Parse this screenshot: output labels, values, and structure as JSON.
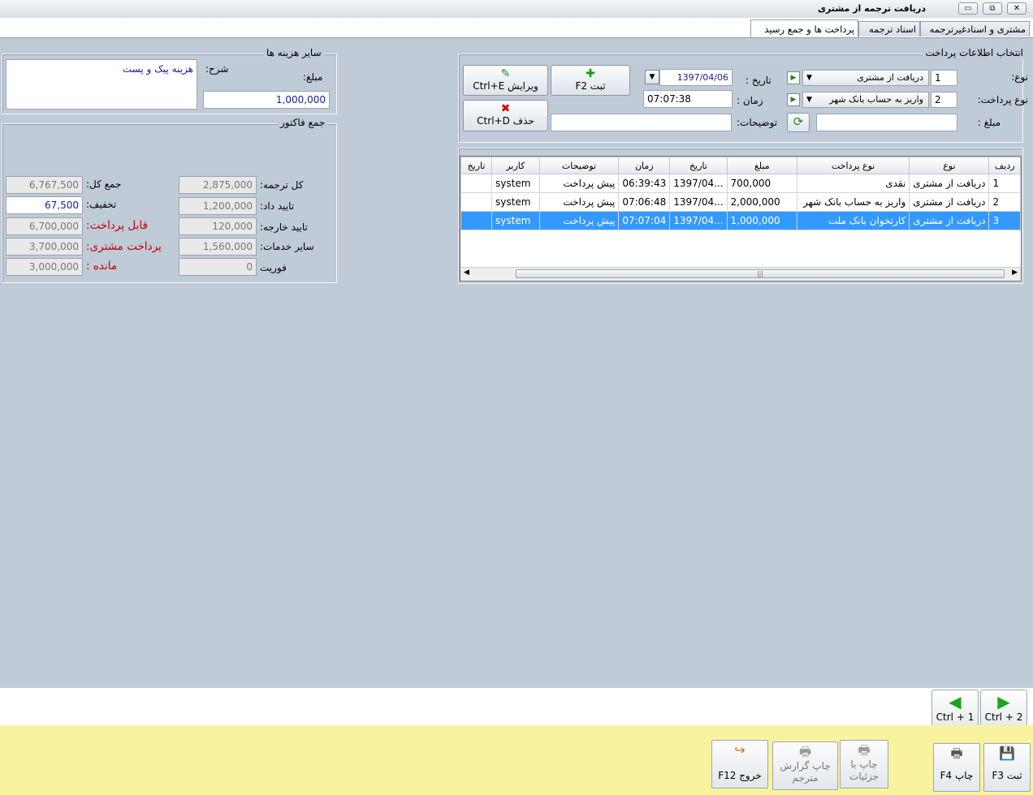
{
  "window": {
    "title": "دریافت ترجمه از مشتری"
  },
  "tabs": [
    {
      "label": "مشتری و اسنادغیرترجمه"
    },
    {
      "label": "اسناد ترجمه"
    },
    {
      "label": "پرداخت ها و جمع رسید"
    }
  ],
  "payment": {
    "title": "انتخاب اطلاعات پرداخت",
    "type_label": "نوع:",
    "type_code": "1",
    "type_value": "دریافت از مشتری",
    "paytype_label": "نوع پرداخت:",
    "paytype_code": "2",
    "paytype_value": "واریز به حساب بانک شهر",
    "amount_label": "مبلغ :",
    "amount_value": "",
    "date_label": "تاریخ :",
    "date_value": "1397/04/06",
    "time_label": "زمان :",
    "time_value": "07:07:38",
    "desc_label": "توضیحات:",
    "desc_value": "",
    "save_btn": "ثبت  F2",
    "edit_btn": "ویرایش  Ctrl+E",
    "delete_btn": "حذف    Ctrl+D"
  },
  "grid": {
    "columns": [
      "ردیف",
      "نوع",
      "نوع پرداخت",
      "مبلغ",
      "تاریخ",
      "زمان",
      "توضیحات",
      "کاربر",
      "تاریخ"
    ],
    "rows": [
      {
        "idx": "1",
        "type": "دریافت از مشتری",
        "paytype": "نقدی",
        "amount": "700,000",
        "date": "1397/04...",
        "time": "06:39:43",
        "desc": "پیش پرداخت",
        "user": "system",
        "date2": ""
      },
      {
        "idx": "2",
        "type": "دریافت از مشتری",
        "paytype": "واریز به حساب بانک شهر",
        "amount": "2,000,000",
        "date": "1397/04...",
        "time": "07:06:48",
        "desc": "پیش پرداخت",
        "user": "system",
        "date2": ""
      },
      {
        "idx": "3",
        "type": "دریافت از مشتری",
        "paytype": "کارتخوان بانک ملت",
        "amount": "1,000,000",
        "date": "1397/04...",
        "time": "07:07:04",
        "desc": "پیش پرداخت",
        "user": "system",
        "date2": ""
      }
    ],
    "selected_row": 3
  },
  "other_costs": {
    "title": "سایر هزینه ها",
    "desc_label": "شرح:",
    "desc_value": "هزینه پیک و پست",
    "amount_label": "مبلغ:",
    "amount_value": "1,000,000"
  },
  "invoice": {
    "title": "جمع فاکتور",
    "translation_total_label": "کل ترجمه:",
    "translation_total": "2,875,000",
    "confirm_label": "تایید داد:",
    "confirm": "1,200,000",
    "foreign_confirm_label": "تایید خارجه:",
    "foreign_confirm": "120,000",
    "other_services_label": "سایر خدمات:",
    "other_services": "1,560,000",
    "urgency_label": "فوریت",
    "urgency": "0",
    "grand_total_label": "جمع کل:",
    "grand_total": "6,767,500",
    "discount_label": "تخفیف:",
    "discount": "67,500",
    "payable_label": "قابل پرداخت:",
    "payable": "6,700,000",
    "customer_paid_label": "پرداخت مشتری:",
    "customer_paid": "3,700,000",
    "remaining_label": "مانده :",
    "remaining": "3,000,000"
  },
  "nav": {
    "next": "Ctrl + 2",
    "prev": "Ctrl + 1"
  },
  "bottom_buttons": {
    "save": "ثبت  F3",
    "print": "چاپ  F4",
    "print_details_1": "چاپ با",
    "print_details_2": "جزئیات",
    "print_translator_1": "چاپ گزارش",
    "print_translator_2": "مترجم",
    "exit": "خروج  F12"
  },
  "colors": {
    "selection": "#3399ff",
    "accent_red": "#c00000",
    "footer": "#f9f3a0"
  }
}
